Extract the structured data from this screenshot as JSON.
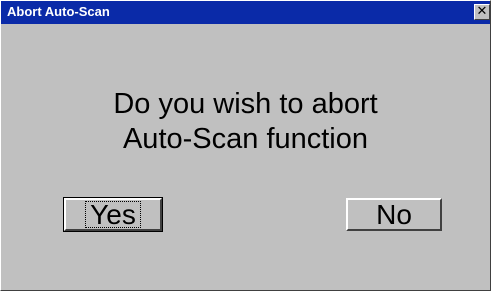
{
  "window": {
    "title": "Abort Auto-Scan",
    "close_glyph": "✕",
    "titlebar_color": "#0a2aa8",
    "face_color": "#c0c0c0"
  },
  "message": {
    "line1": "Do you wish to abort",
    "line2": "Auto-Scan function"
  },
  "buttons": {
    "yes_label": "Yes",
    "no_label": "No"
  }
}
